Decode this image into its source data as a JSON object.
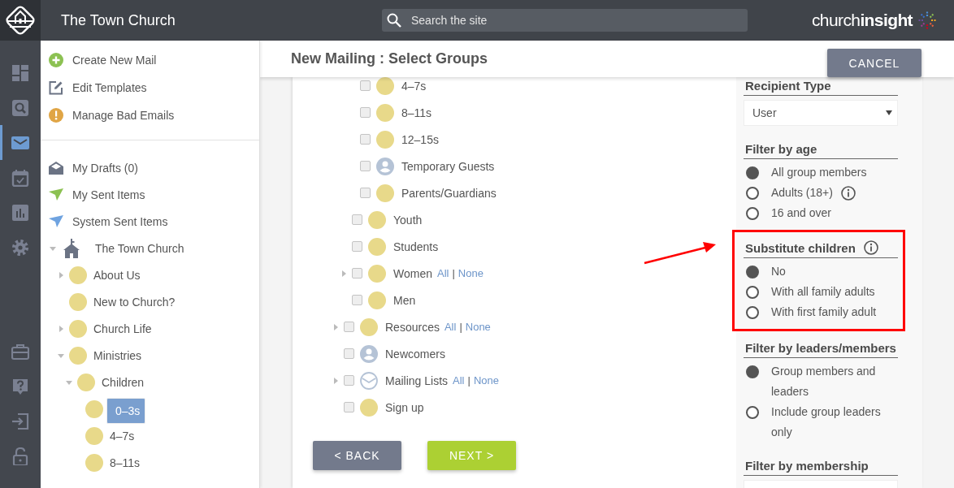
{
  "header": {
    "site_title": "The Town Church",
    "search": {
      "placeholder": "Search the site"
    },
    "brand": "church**insight**"
  },
  "rail": {
    "top": [
      {
        "kind": "dashboard",
        "selected": false
      },
      {
        "kind": "search",
        "selected": false
      },
      {
        "kind": "mail",
        "selected": true
      },
      {
        "kind": "calendar",
        "selected": false
      },
      {
        "kind": "chart",
        "selected": false
      },
      {
        "kind": "settings",
        "selected": false
      }
    ],
    "bottom": [
      {
        "kind": "briefcase",
        "selected": false
      },
      {
        "kind": "help",
        "selected": false
      },
      {
        "kind": "sign-in",
        "selected": false
      },
      {
        "kind": "lock",
        "selected": false
      }
    ]
  },
  "sidebar": {
    "actions": [
      {
        "kind": "add",
        "label": "Create New Mail"
      },
      {
        "kind": "edit",
        "label": "Edit Templates"
      },
      {
        "kind": "warning",
        "label": "Manage Bad Emails"
      }
    ],
    "folders": [
      {
        "kind": "drafts",
        "label": "My Drafts (0)"
      },
      {
        "kind": "sent",
        "label": "My Sent Items"
      },
      {
        "kind": "system-sent",
        "label": "System Sent Items"
      }
    ],
    "tree": [
      {
        "label": "The Town Church",
        "kind": "church",
        "expanded": true,
        "selected": false,
        "children": [
          {
            "label": "About Us",
            "kind": "group",
            "expanded": false,
            "selected": false
          },
          {
            "label": "New to Church?",
            "kind": "group",
            "selected": false
          },
          {
            "label": "Church Life",
            "kind": "group",
            "expanded": false,
            "selected": false
          },
          {
            "label": "Ministries",
            "kind": "group",
            "expanded": true,
            "selected": false,
            "children": [
              {
                "label": "Children",
                "kind": "group",
                "expanded": true,
                "selected": false,
                "children": [
                  {
                    "label": "0–3s",
                    "kind": "group",
                    "selected": true
                  },
                  {
                    "label": "4–7s",
                    "kind": "group",
                    "selected": false
                  },
                  {
                    "label": "8–11s",
                    "kind": "group",
                    "selected": false
                  }
                ]
              }
            ]
          }
        ]
      }
    ]
  },
  "page": {
    "title": "New Mailing : Select Groups",
    "cancel": "CANCEL",
    "back": "< BACK",
    "next": "NEXT >"
  },
  "groups": [
    {
      "children": [
        {
          "children": [
            {
              "label": "4–7s",
              "kind": "group",
              "checked": false
            },
            {
              "label": "8–11s",
              "kind": "group",
              "checked": false
            },
            {
              "label": "12–15s",
              "kind": "group",
              "checked": false
            },
            {
              "label": "Temporary Guests",
              "kind": "person",
              "checked": false
            },
            {
              "label": "Parents/Guardians",
              "kind": "group",
              "checked": false
            }
          ]
        },
        {
          "label": "Youth",
          "kind": "group",
          "checked": false
        },
        {
          "label": "Students",
          "kind": "group",
          "checked": false
        },
        {
          "label": "Women",
          "kind": "group",
          "checked": false,
          "expanded": false,
          "links": [
            "All",
            "None"
          ],
          "separator": "|"
        },
        {
          "label": "Men",
          "kind": "group",
          "checked": false
        }
      ]
    },
    {
      "label": "Resources",
      "kind": "group",
      "checked": false,
      "expanded": false,
      "links": [
        "All",
        "None"
      ],
      "separator": "|"
    },
    {
      "label": "Newcomers",
      "kind": "person",
      "checked": false
    },
    {
      "label": "Mailing Lists",
      "kind": "mail",
      "checked": false,
      "expanded": false,
      "links": [
        "All",
        "None"
      ],
      "separator": "|"
    },
    {
      "label": "Sign up",
      "kind": "group",
      "checked": false
    }
  ],
  "filters": [
    {
      "kind": "select",
      "title": "Recipient Type",
      "value": "User",
      "info": false,
      "highlighted": false
    },
    {
      "kind": "radio",
      "title": "Filter by age",
      "info": false,
      "highlighted": false,
      "options": [
        {
          "label": "All group members",
          "selected": true,
          "info": false
        },
        {
          "label": "Adults (18+)",
          "selected": false,
          "info": true
        },
        {
          "label": "16 and over",
          "selected": false,
          "info": false
        }
      ]
    },
    {
      "kind": "radio",
      "title": "Substitute children",
      "info": true,
      "highlighted": true,
      "options": [
        {
          "label": "No",
          "selected": true,
          "info": false
        },
        {
          "label": "With all family adults",
          "selected": false,
          "info": false
        },
        {
          "label": "With first family adult",
          "selected": false,
          "info": false
        }
      ]
    },
    {
      "kind": "radio",
      "title": "Filter by leaders/members",
      "info": false,
      "highlighted": false,
      "options": [
        {
          "label": "Group members and leaders",
          "selected": true,
          "info": false
        },
        {
          "label": "Include group leaders only",
          "selected": false,
          "info": false
        }
      ]
    },
    {
      "kind": "select",
      "title": "Filter by membership",
      "info": false,
      "highlighted": false
    }
  ]
}
